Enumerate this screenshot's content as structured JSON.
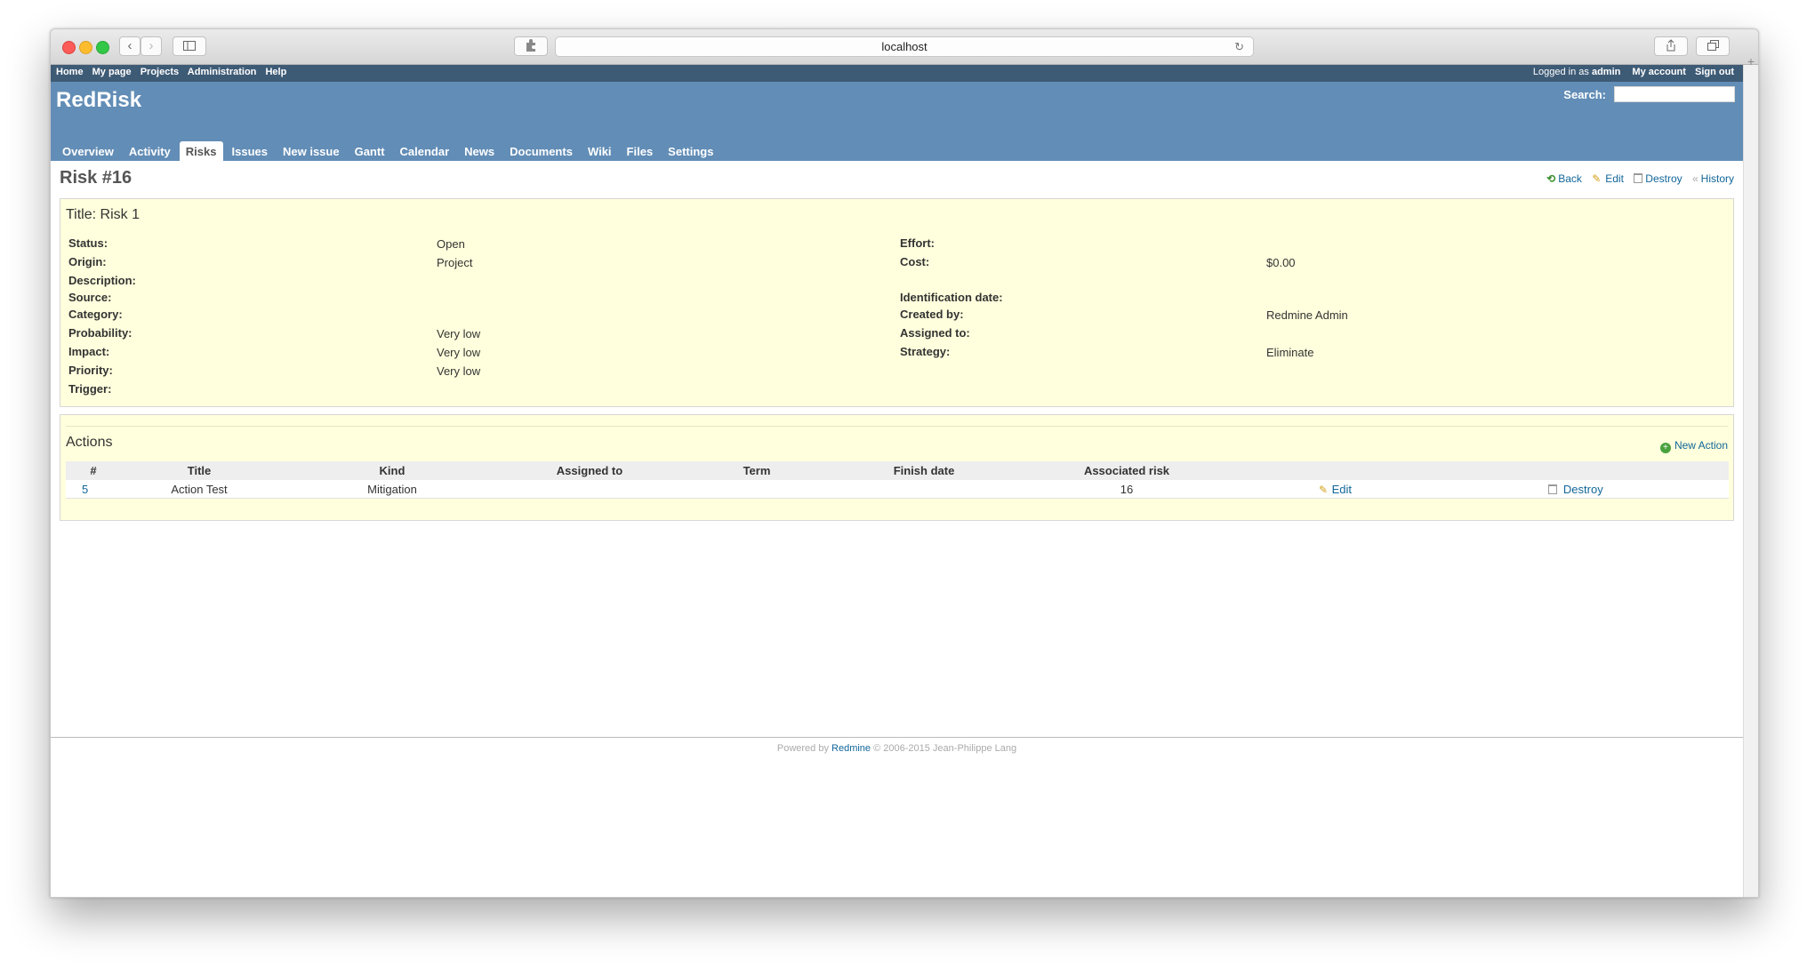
{
  "browser": {
    "url": "localhost"
  },
  "topmenu": {
    "left": [
      "Home",
      "My page",
      "Projects",
      "Administration",
      "Help"
    ],
    "logged_prefix": "Logged in as",
    "logged_user": "admin",
    "my_account": "My account",
    "sign_out": "Sign out"
  },
  "header": {
    "site_title": "RedRisk",
    "search_label": "Search:",
    "search_value": ""
  },
  "tabs": [
    "Overview",
    "Activity",
    "Risks",
    "Issues",
    "New issue",
    "Gantt",
    "Calendar",
    "News",
    "Documents",
    "Wiki",
    "Files",
    "Settings"
  ],
  "selected_tab": "Risks",
  "page": {
    "heading": "Risk #16",
    "contextual": {
      "back": "Back",
      "edit": "Edit",
      "destroy": "Destroy",
      "history": "History"
    }
  },
  "risk": {
    "title": "Title: Risk 1",
    "left": [
      {
        "label": "Status:",
        "value": "Open"
      },
      {
        "label": "Origin:",
        "value": "Project"
      },
      {
        "label": "Description:",
        "value": ""
      },
      {
        "label": "Source:",
        "value": ""
      },
      {
        "label": "Category:",
        "value": ""
      },
      {
        "label": "Probability:",
        "value": "Very low"
      },
      {
        "label": "Impact:",
        "value": "Very low"
      },
      {
        "label": "Priority:",
        "value": "Very low"
      },
      {
        "label": "Trigger:",
        "value": ""
      }
    ],
    "right": [
      {
        "label": "Effort:",
        "value": ""
      },
      {
        "label": "Cost:",
        "value": "$0.00"
      },
      {
        "label": "Identification date:",
        "value": ""
      },
      {
        "label": "Created by:",
        "value": "Redmine Admin"
      },
      {
        "label": "Assigned to:",
        "value": ""
      },
      {
        "label": "Strategy:",
        "value": "Eliminate"
      }
    ]
  },
  "actions": {
    "heading": "Actions",
    "new_action": "New Action",
    "columns": [
      "#",
      "Title",
      "Kind",
      "Assigned to",
      "Term",
      "Finish date",
      "Associated risk",
      "",
      ""
    ],
    "rows": [
      {
        "id": "5",
        "title": "Action Test",
        "kind": "Mitigation",
        "assigned_to": "",
        "term": "",
        "finish_date": "",
        "associated_risk": "16",
        "edit": "Edit",
        "destroy": "Destroy"
      }
    ]
  },
  "footer": {
    "prefix": "Powered by",
    "link": "Redmine",
    "suffix": "© 2006-2015 Jean-Philippe Lang"
  }
}
